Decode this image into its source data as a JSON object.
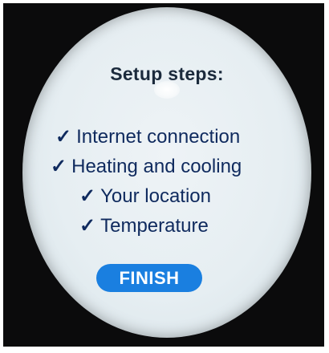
{
  "screen": {
    "title": "Setup steps:",
    "steps": [
      {
        "check": "✓",
        "label": "Internet connection"
      },
      {
        "check": "✓",
        "label": "Heating and cooling"
      },
      {
        "check": "✓",
        "label": "Your location"
      },
      {
        "check": "✓",
        "label": "Temperature"
      }
    ],
    "finish_label": "FINISH"
  },
  "colors": {
    "screen_background": "#e6eef2",
    "title_text": "#1b2a3c",
    "step_text": "#0f2a5e",
    "button_background": "#1a7fe0",
    "button_text": "#ffffff",
    "bezel": "#0b0b0c"
  }
}
